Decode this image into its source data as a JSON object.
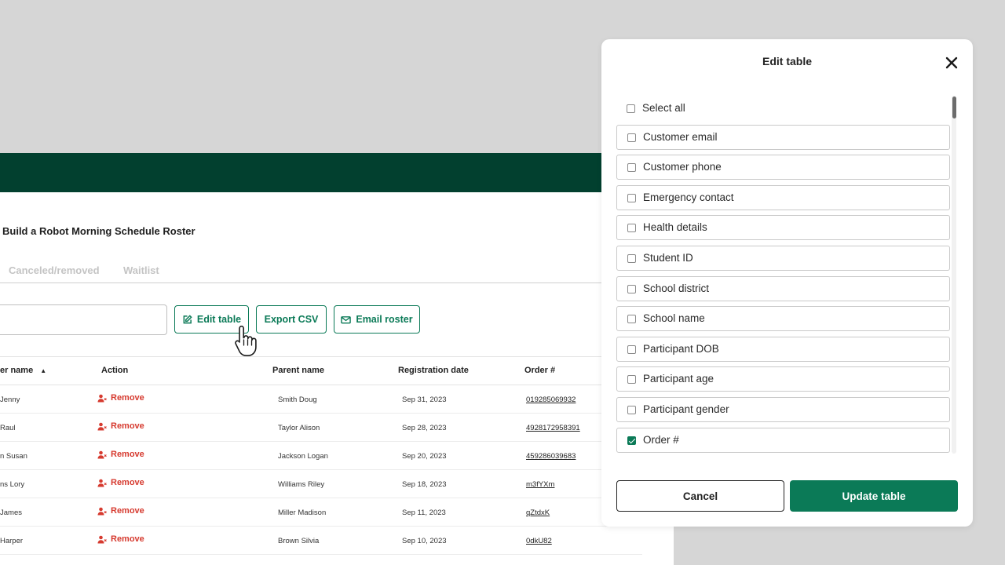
{
  "page": {
    "title": "Build a Robot Morning Schedule Roster"
  },
  "tabs": [
    {
      "label": "Canceled/removed"
    },
    {
      "label": "Waitlist"
    }
  ],
  "toolbar": {
    "edit_label": "Edit table",
    "export_label": "Export CSV",
    "email_label": "Email roster"
  },
  "table": {
    "headers": {
      "participant": "er name",
      "action": "Action",
      "parent": "Parent name",
      "date": "Registration date",
      "order": "Order #"
    },
    "sort_indicator": "▲",
    "remove_label": "Remove",
    "rows": [
      {
        "participant": "Jenny",
        "parent": "Smith Doug",
        "date": "Sep 31, 2023",
        "order": "019285069932"
      },
      {
        "participant": "Raul",
        "parent": "Taylor Alison",
        "date": "Sep 28, 2023",
        "order": "4928172958391"
      },
      {
        "participant": "n Susan",
        "parent": "Jackson Logan",
        "date": "Sep 20, 2023",
        "order": "459286039683"
      },
      {
        "participant": "ns Lory",
        "parent": "Williams Riley",
        "date": "Sep 18, 2023",
        "order": "m3fYXm"
      },
      {
        "participant": "James",
        "parent": "Miller Madison",
        "date": "Sep 11, 2023",
        "order": "qZtdxK"
      },
      {
        "participant": "Harper",
        "parent": "Brown Silvia",
        "date": "Sep 10, 2023",
        "order": "0dkU82"
      }
    ]
  },
  "modal": {
    "title": "Edit table",
    "close_icon": "close-icon",
    "options": [
      {
        "label": "Select all",
        "checked": false
      },
      {
        "label": "Customer email",
        "checked": false
      },
      {
        "label": "Customer phone",
        "checked": false
      },
      {
        "label": "Emergency contact",
        "checked": false
      },
      {
        "label": "Health details",
        "checked": false
      },
      {
        "label": "Student ID",
        "checked": false
      },
      {
        "label": "School district",
        "checked": false
      },
      {
        "label": "School name",
        "checked": false
      },
      {
        "label": "Participant DOB",
        "checked": false
      },
      {
        "label": "Participant age",
        "checked": false
      },
      {
        "label": "Participant gender",
        "checked": false
      },
      {
        "label": "Order #",
        "checked": true
      }
    ],
    "cancel_label": "Cancel",
    "update_label": "Update table"
  },
  "colors": {
    "brand_dark": "#02402f",
    "accent": "#0b7a57",
    "danger": "#d63a2f"
  }
}
